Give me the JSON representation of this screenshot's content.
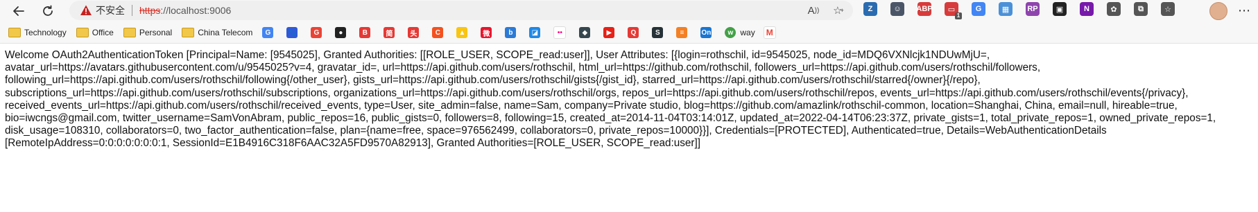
{
  "toolbar": {
    "back_icon": "arrow-left-icon",
    "refresh_icon": "refresh-icon",
    "insecure_label": "不安全",
    "url_scheme": "https",
    "url_rest": "://localhost:9006",
    "read_aloud_icon": "read-aloud-icon",
    "favorite_icon": "add-favorite-icon",
    "extensions": [
      {
        "name": "zotero",
        "label": "Z",
        "color": "#2b6cb0"
      },
      {
        "name": "face",
        "label": "☺",
        "color": "#4a5568"
      },
      {
        "name": "adblock",
        "label": "ABP",
        "color": "#d73b3b"
      },
      {
        "name": "notification",
        "label": "▭",
        "color": "#d73b3b",
        "badge": "1"
      },
      {
        "name": "translate",
        "label": "G",
        "color": "#4285f4"
      },
      {
        "name": "picture",
        "label": "▦",
        "color": "#4a90d9"
      },
      {
        "name": "rp",
        "label": "RP",
        "color": "#8e44ad"
      },
      {
        "name": "snippet",
        "label": "▣",
        "color": "#222222"
      },
      {
        "name": "onenote",
        "label": "N",
        "color": "#7719aa"
      },
      {
        "name": "extensions",
        "label": "✿",
        "color": "#555555"
      },
      {
        "name": "collections",
        "label": "⧉",
        "color": "#555555"
      },
      {
        "name": "add-favorite",
        "label": "☆",
        "color": "#555555"
      }
    ],
    "more_icon": "more-icon"
  },
  "bookmarks": {
    "folders": [
      "Technology",
      "Office",
      "Personal",
      "China Telecom"
    ],
    "icons": [
      {
        "name": "translate",
        "label": "G",
        "color": "#4285f4"
      },
      {
        "name": "baidu",
        "label": "🐾",
        "color": "#2f59d9"
      },
      {
        "name": "google",
        "label": "G",
        "color": "#ea4335"
      },
      {
        "name": "github",
        "label": "●",
        "color": "#222222"
      },
      {
        "name": "b-red",
        "label": "B",
        "color": "#e53935"
      },
      {
        "name": "jian",
        "label": "简",
        "color": "#e53935"
      },
      {
        "name": "toutiao",
        "label": "头",
        "color": "#e53935"
      },
      {
        "name": "c-orange",
        "label": "C",
        "color": "#f4511e"
      },
      {
        "name": "yellow",
        "label": "▲",
        "color": "#f9c513"
      },
      {
        "name": "weibo",
        "label": "微",
        "color": "#e6162d"
      },
      {
        "name": "bing",
        "label": "b",
        "color": "#2b7bd6"
      },
      {
        "name": "blue-box",
        "label": "◪",
        "color": "#1e88e5"
      },
      {
        "name": "flickr",
        "label": "••",
        "color": "#ffffff"
      },
      {
        "name": "dolphin",
        "label": "◆",
        "color": "#37474f"
      },
      {
        "name": "youtube",
        "label": "▶",
        "color": "#e62117"
      },
      {
        "name": "q-red",
        "label": "Q",
        "color": "#e53935"
      },
      {
        "name": "s-dark",
        "label": "S",
        "color": "#263238"
      },
      {
        "name": "stackoverflow",
        "label": "≡",
        "color": "#f48024"
      },
      {
        "name": "on",
        "label": "On",
        "color": "#1976d2"
      }
    ],
    "way_label": "way",
    "gmail_icon": "gmail-icon"
  },
  "content": {
    "text": "Welcome OAuth2AuthenticationToken [Principal=Name: [9545025], Granted Authorities: [[ROLE_USER, SCOPE_read:user]], User Attributes: [{login=rothschil, id=9545025, node_id=MDQ6VXNlcjk1NDUwMjU=, avatar_url=https://avatars.githubusercontent.com/u/9545025?v=4, gravatar_id=, url=https://api.github.com/users/rothschil, html_url=https://github.com/rothschil, followers_url=https://api.github.com/users/rothschil/followers, following_url=https://api.github.com/users/rothschil/following{/other_user}, gists_url=https://api.github.com/users/rothschil/gists{/gist_id}, starred_url=https://api.github.com/users/rothschil/starred{/owner}{/repo}, subscriptions_url=https://api.github.com/users/rothschil/subscriptions, organizations_url=https://api.github.com/users/rothschil/orgs, repos_url=https://api.github.com/users/rothschil/repos, events_url=https://api.github.com/users/rothschil/events{/privacy}, received_events_url=https://api.github.com/users/rothschil/received_events, type=User, site_admin=false, name=Sam, company=Private studio, blog=https://github.com/amazlink/rothschil-common, location=Shanghai, China, email=null, hireable=true, bio=iwcngs@gmail.com, twitter_username=SamVonAbram, public_repos=16, public_gists=0, followers=8, following=15, created_at=2014-11-04T03:14:01Z, updated_at=2022-04-14T06:23:37Z, private_gists=1, total_private_repos=1, owned_private_repos=1, disk_usage=108310, collaborators=0, two_factor_authentication=false, plan={name=free, space=976562499, collaborators=0, private_repos=10000}}], Credentials=[PROTECTED], Authenticated=true, Details=WebAuthenticationDetails [RemoteIpAddress=0:0:0:0:0:0:0:1, SessionId=E1B4916C318F6AAC32A5FD9570A82913], Granted Authorities=[ROLE_USER, SCOPE_read:user]]"
  }
}
